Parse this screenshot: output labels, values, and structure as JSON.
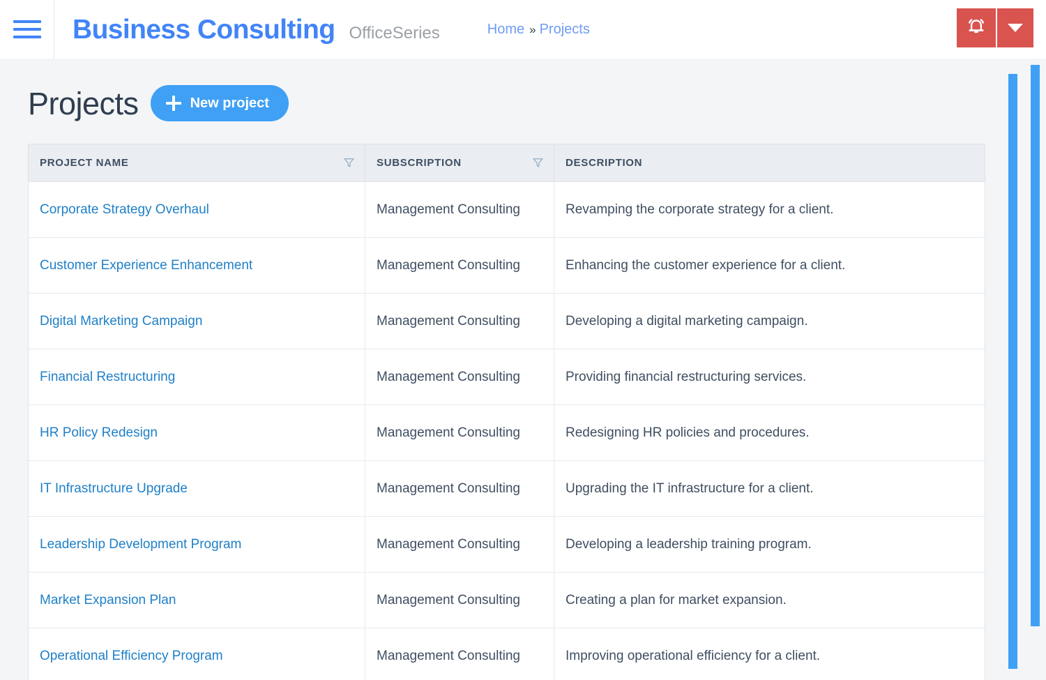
{
  "header": {
    "menu_icon": "hamburger-menu-icon",
    "brand_title": "Business Consulting",
    "brand_subtitle": "OfficeSeries",
    "breadcrumb": {
      "home": "Home",
      "separator": "»",
      "current": "Projects"
    },
    "notification_icon": "alarm-bell-icon",
    "dropdown_icon": "chevron-down-icon",
    "accent_red": "#d9534f",
    "accent_blue": "#4184f7"
  },
  "page": {
    "title": "Projects",
    "new_button_label": "New project",
    "new_button_icon": "plus-icon",
    "new_button_color": "#3fa0f5"
  },
  "table": {
    "columns": [
      {
        "label": "PROJECT NAME",
        "filterable": true,
        "filter_icon": "funnel-filter-icon"
      },
      {
        "label": "SUBSCRIPTION",
        "filterable": true,
        "filter_icon": "funnel-filter-icon"
      },
      {
        "label": "DESCRIPTION",
        "filterable": false
      }
    ],
    "rows": [
      {
        "name": "Corporate Strategy Overhaul",
        "subscription": "Management Consulting",
        "description": "Revamping the corporate strategy for a client."
      },
      {
        "name": "Customer Experience Enhancement",
        "subscription": "Management Consulting",
        "description": "Enhancing the customer experience for a client."
      },
      {
        "name": "Digital Marketing Campaign",
        "subscription": "Management Consulting",
        "description": "Developing a digital marketing campaign."
      },
      {
        "name": "Financial Restructuring",
        "subscription": "Management Consulting",
        "description": "Providing financial restructuring services."
      },
      {
        "name": "HR Policy Redesign",
        "subscription": "Management Consulting",
        "description": "Redesigning HR policies and procedures."
      },
      {
        "name": "IT Infrastructure Upgrade",
        "subscription": "Management Consulting",
        "description": "Upgrading the IT infrastructure for a client."
      },
      {
        "name": "Leadership Development Program",
        "subscription": "Management Consulting",
        "description": "Developing a leadership training program."
      },
      {
        "name": "Market Expansion Plan",
        "subscription": "Management Consulting",
        "description": "Creating a plan for market expansion."
      },
      {
        "name": "Operational Efficiency Program",
        "subscription": "Management Consulting",
        "description": "Improving operational efficiency for a client."
      }
    ]
  },
  "scrollbars": {
    "inner_color": "#3fa0f5",
    "outer_color": "#3fa0f5"
  }
}
